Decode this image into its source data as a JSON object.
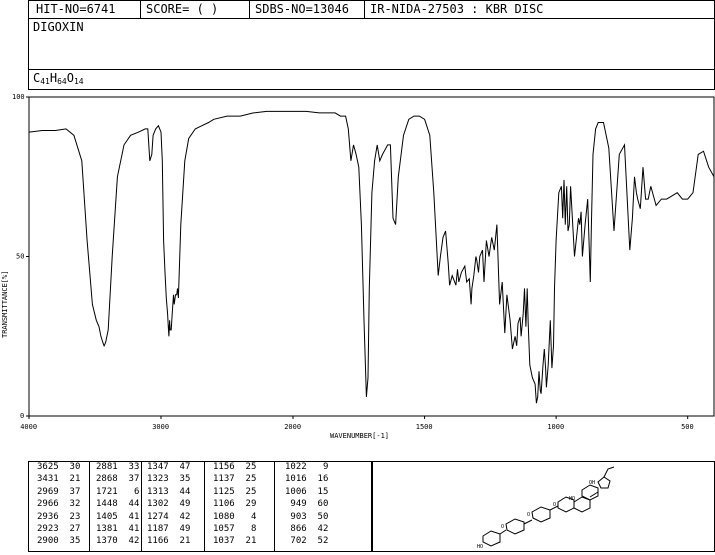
{
  "header": {
    "hit_no": "HIT-NO=6741",
    "score": "SCORE=  (   )",
    "sdbs_no": "SDBS-NO=13046",
    "ir_nida": "IR-NIDA-27503 : KBR DISC"
  },
  "compound": {
    "name": "DIGOXIN",
    "formula_parts": {
      "c": "C",
      "c_n": "41",
      "h": "H",
      "h_n": "64",
      "o": "O",
      "o_n": "14"
    }
  },
  "chart_data": {
    "type": "line",
    "xlabel": "WAVENUMBER[-1]",
    "ylabel": "TRANSMITTANCE[%]",
    "xlim": [
      4000,
      400
    ],
    "ylim": [
      0,
      100
    ],
    "x_ticks": [
      "4000",
      "3000",
      "2000",
      "1500",
      "1000",
      "500"
    ],
    "y_ticks": [
      "0",
      "50",
      "100"
    ],
    "x": [
      4000,
      3900,
      3800,
      3720,
      3660,
      3600,
      3560,
      3520,
      3490,
      3470,
      3455,
      3440,
      3431,
      3420,
      3400,
      3370,
      3330,
      3280,
      3230,
      3170,
      3120,
      3100,
      3085,
      3070,
      3060,
      3040,
      3020,
      3000,
      2990,
      2980,
      2970,
      2960,
      2950,
      2945,
      2940,
      2935,
      2930,
      2923,
      2915,
      2905,
      2900,
      2890,
      2881,
      2875,
      2868,
      2850,
      2820,
      2790,
      2740,
      2690,
      2640,
      2600,
      2500,
      2400,
      2300,
      2200,
      2100,
      2000,
      1950,
      1900,
      1870,
      1840,
      1820,
      1800,
      1790,
      1780,
      1770,
      1760,
      1750,
      1740,
      1730,
      1721,
      1715,
      1710,
      1700,
      1690,
      1680,
      1670,
      1660,
      1640,
      1630,
      1620,
      1610,
      1600,
      1580,
      1560,
      1540,
      1520,
      1500,
      1480,
      1465,
      1448,
      1440,
      1430,
      1420,
      1410,
      1405,
      1395,
      1381,
      1375,
      1370,
      1360,
      1347,
      1340,
      1330,
      1323,
      1320,
      1313,
      1305,
      1302,
      1295,
      1290,
      1280,
      1274,
      1265,
      1255,
      1245,
      1235,
      1225,
      1215,
      1205,
      1195,
      1187,
      1175,
      1166,
      1156,
      1150,
      1145,
      1137,
      1133,
      1125,
      1120,
      1115,
      1110,
      1106,
      1100,
      1090,
      1080,
      1075,
      1070,
      1065,
      1060,
      1057,
      1050,
      1045,
      1040,
      1037,
      1030,
      1022,
      1016,
      1010,
      1006,
      1000,
      990,
      980,
      975,
      970,
      965,
      960,
      955,
      950,
      945,
      930,
      920,
      915,
      910,
      905,
      900,
      890,
      880,
      870,
      866,
      860,
      850,
      840,
      820,
      800,
      780,
      760,
      740,
      720,
      710,
      702,
      695,
      690,
      680,
      670,
      660,
      650,
      640,
      620,
      600,
      580,
      560,
      540,
      520,
      500,
      480,
      460,
      440,
      420,
      400
    ],
    "y": [
      89,
      89.5,
      89.5,
      90,
      88,
      80,
      55,
      35,
      30,
      28,
      25,
      23,
      22,
      23,
      27,
      50,
      75,
      85,
      88,
      89,
      90,
      90,
      80,
      82,
      88,
      90,
      91,
      89,
      80,
      55,
      45,
      37,
      32,
      28,
      25,
      30,
      27,
      27,
      32,
      38,
      35,
      38,
      38,
      40,
      37,
      60,
      80,
      87,
      90,
      91,
      92,
      93,
      94,
      94,
      95,
      95.5,
      95.5,
      95.5,
      95.5,
      95,
      95,
      95,
      94,
      94,
      90,
      80,
      85,
      82,
      78,
      60,
      30,
      6,
      12,
      40,
      70,
      80,
      85,
      80,
      82,
      85,
      85,
      62,
      60,
      75,
      88,
      93,
      94,
      94,
      93,
      88,
      70,
      44,
      50,
      56,
      58,
      48,
      41,
      44,
      41,
      46,
      42,
      45,
      47,
      42,
      43,
      35,
      40,
      44,
      50,
      49,
      45,
      50,
      52,
      42,
      55,
      50,
      56,
      52,
      60,
      35,
      42,
      26,
      38,
      30,
      21,
      25,
      22,
      29,
      31,
      25,
      32,
      40,
      28,
      40,
      29,
      16,
      12,
      10,
      4,
      6,
      14,
      8,
      7,
      16,
      21,
      15,
      9,
      16,
      30,
      15,
      22,
      40,
      55,
      70,
      72,
      62,
      74,
      60,
      72,
      58,
      60,
      72,
      50,
      58,
      62,
      60,
      64,
      50,
      60,
      68,
      42,
      60,
      82,
      90,
      92,
      92,
      84,
      58,
      82,
      85,
      52,
      62,
      75,
      70,
      68,
      65,
      78,
      68,
      68,
      72,
      66,
      68,
      68,
      69,
      70,
      68,
      68,
      70,
      82,
      83,
      78,
      75,
      74
    ]
  },
  "peak_table": {
    "columns": [
      {
        "wn": [
          "3625",
          "3431",
          "2969",
          "2966",
          "2936",
          "2923",
          "2900"
        ],
        "t": [
          "30",
          "21",
          "37",
          "32",
          "23",
          "27",
          "35"
        ]
      },
      {
        "wn": [
          "2881",
          "2868",
          "1721",
          "1448",
          "1405",
          "1381",
          "1370"
        ],
        "t": [
          "33",
          "37",
          "6",
          "44",
          "41",
          "41",
          "42"
        ]
      },
      {
        "wn": [
          "1347",
          "1323",
          "1313",
          "1302",
          "1274",
          "1187",
          "1166"
        ],
        "t": [
          "47",
          "35",
          "44",
          "49",
          "42",
          "49",
          "21"
        ]
      },
      {
        "wn": [
          "1156",
          "1137",
          "1125",
          "1106",
          "1080",
          "1057",
          "1037"
        ],
        "t": [
          "25",
          "25",
          "25",
          "29",
          "4",
          "8",
          "21"
        ]
      },
      {
        "wn": [
          "1022",
          "1016",
          "1006",
          "949",
          "903",
          "866",
          "702"
        ],
        "t": [
          "9",
          "16",
          "15",
          "60",
          "50",
          "42",
          "52"
        ]
      }
    ]
  }
}
